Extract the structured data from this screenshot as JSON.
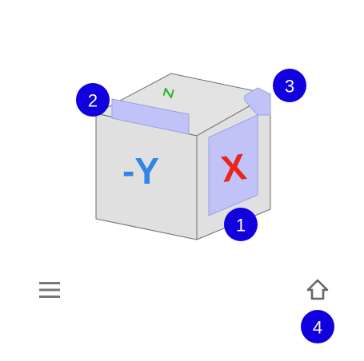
{
  "viewcube": {
    "faces": {
      "front_label": "-Y",
      "right_label": "X",
      "top_label": "Z"
    },
    "colors": {
      "face_fill": "#e0e0e0",
      "edge": "#6e6e6e",
      "highlight": "#c0c2f8",
      "highlight_edge": "#9aa0e0",
      "y_axis": "#2f86e8",
      "x_axis": "#e8261c",
      "z_axis": "#1fba2a",
      "badge": "#1100dd"
    }
  },
  "callouts": {
    "one": "1",
    "two": "2",
    "three": "3",
    "four": "4"
  },
  "toolbar": {
    "menu_icon": "hamburger-menu-icon",
    "home_icon": "home-icon"
  }
}
